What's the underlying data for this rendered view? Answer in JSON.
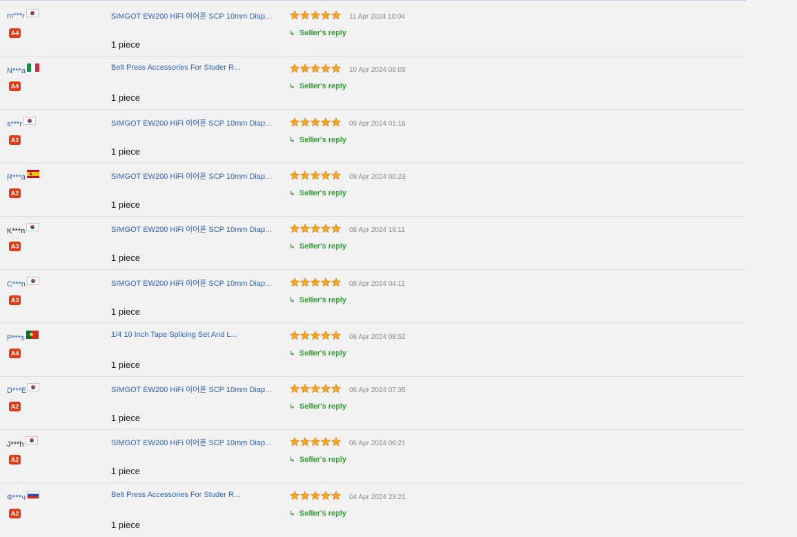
{
  "reviews": [
    {
      "buyer": "m***r",
      "flag": "kr-flag-icon",
      "level": "A4",
      "product": "SIMGOT EW200 HiFi 이어폰 SCP 10mm Diap...",
      "quantity": "1 piece",
      "date": "11 Apr 2024 10:04",
      "reply": "Seller's reply"
    },
    {
      "buyer": "N***a",
      "flag": "it-flag-icon",
      "level": "A4",
      "product": "Belt Press Accessories For Studer R...",
      "quantity": "1 piece",
      "date": "10 Apr 2024 06:03",
      "reply": "Seller's reply"
    },
    {
      "buyer": "s***r",
      "flag": "kr-flag-icon",
      "level": "A2",
      "product": "SIMGOT EW200 HiFi 이어폰 SCP 10mm Diap...",
      "quantity": "1 piece",
      "date": "09 Apr 2024 01:16",
      "reply": "Seller's reply"
    },
    {
      "buyer": "R***a",
      "flag": "es-flag-icon",
      "level": "A2",
      "product": "SIMGOT EW200 HiFi 이어폰 SCP 10mm Diap...",
      "quantity": "1 piece",
      "date": "09 Apr 2024 00:23",
      "reply": "Seller's reply"
    },
    {
      "buyer": "K***n",
      "flag": "kr-flag-icon",
      "level": "A3",
      "product": "SIMGOT EW200 HiFi 이어폰 SCP 10mm Diap...",
      "quantity": "1 piece",
      "date": "08 Apr 2024 19:11",
      "reply": "Seller's reply"
    },
    {
      "buyer": "C***n",
      "flag": "kr-flag-icon",
      "level": "A3",
      "product": "SIMGOT EW200 HiFi 이어폰 SCP 10mm Diap...",
      "quantity": "1 piece",
      "date": "08 Apr 2024 04:11",
      "reply": "Seller's reply"
    },
    {
      "buyer": "P***s",
      "flag": "pt-flag-icon",
      "level": "A4",
      "product": "1/4 10 Inch Tape Splicing Set And L...",
      "quantity": "1 piece",
      "date": "06 Apr 2024 08:52",
      "reply": "Seller's reply"
    },
    {
      "buyer": "D***E",
      "flag": "kr-flag-icon",
      "level": "A2",
      "product": "SIMGOT EW200 HiFi 이어폰 SCP 10mm Diap...",
      "quantity": "1 piece",
      "date": "06 Apr 2024 07:35",
      "reply": "Seller's reply"
    },
    {
      "buyer": "J***h",
      "flag": "kr-flag-icon",
      "level": "A2",
      "product": "SIMGOT EW200 HiFi 이어폰 SCP 10mm Diap...",
      "quantity": "1 piece",
      "date": "06 Apr 2024 06:21",
      "reply": "Seller's reply"
    },
    {
      "buyer": "Ф***ч",
      "flag": "ru-flag-icon",
      "level": "A2",
      "product": "Belt Press Accessories For Studer R...",
      "quantity": "1 piece",
      "date": "04 Apr 2024 23:21",
      "reply": "Seller's reply"
    }
  ],
  "rating": {
    "stars_filled": 5,
    "stars_total": 5
  },
  "colors": {
    "link": "#2f63b3",
    "badge": "#e03a12",
    "reply": "#2e9e2e",
    "star": "#f5a623"
  }
}
